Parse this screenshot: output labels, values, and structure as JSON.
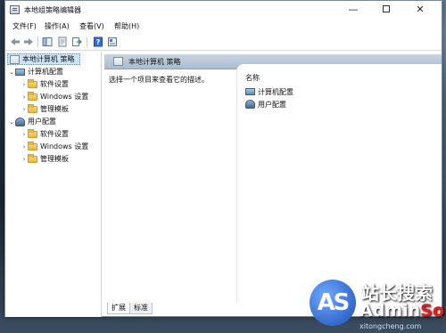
{
  "window": {
    "title": "本地组策略编辑器",
    "controls": {
      "minimize": "—",
      "close": "✕"
    }
  },
  "menu": [
    "文件(F)",
    "操作(A)",
    "查看(V)",
    "帮助(H)"
  ],
  "toolbar": [
    "back-icon",
    "forward-icon",
    "show-hide-tree-icon",
    "properties-icon",
    "export-list-icon",
    "help-icon",
    "view-icon"
  ],
  "tree": {
    "root": "本地计算机 策略",
    "computer": {
      "label": "计算机配置",
      "children": [
        "软件设置",
        "Windows 设置",
        "管理模板"
      ]
    },
    "user": {
      "label": "用户配置",
      "children": [
        "软件设置",
        "Windows 设置",
        "管理模板"
      ]
    }
  },
  "content": {
    "header": "本地计算机 策略",
    "description": "选择一个项目来查看它的描述。",
    "column_name": "名称",
    "items": [
      "计算机配置",
      "用户配置"
    ]
  },
  "tabs": [
    "扩展",
    "标准"
  ],
  "watermark": {
    "logo": "AS",
    "cn": "站长搜索",
    "en_main": "Admin",
    "en_accent": "So",
    "url": "xitongcheng.com"
  }
}
